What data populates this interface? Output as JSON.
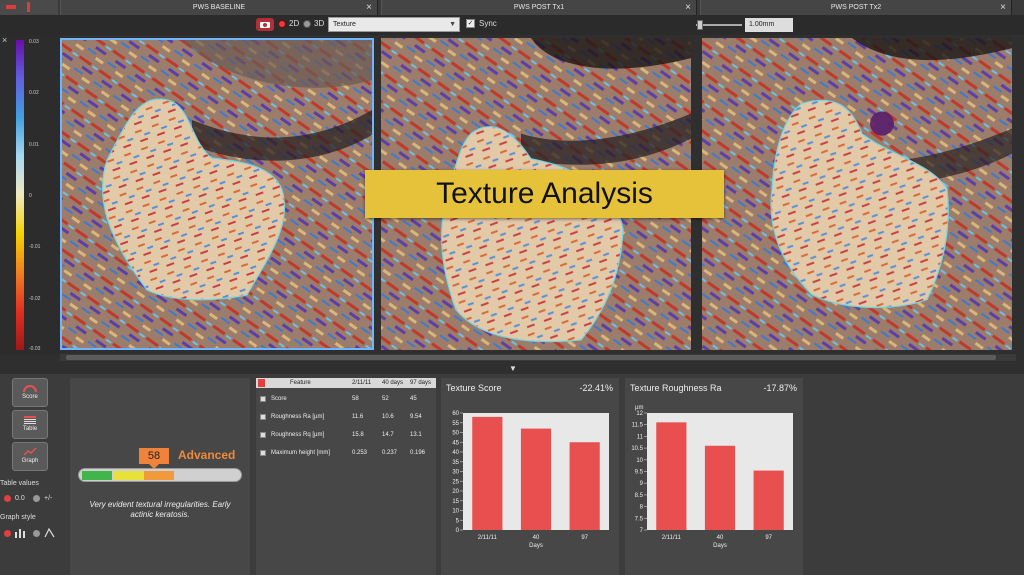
{
  "tabs": [
    {
      "label": "PWS BASELINE"
    },
    {
      "label": "PWS  POST Tx1"
    },
    {
      "label": "PWS POST Tx2"
    }
  ],
  "toolbar": {
    "mode_2d": "2D",
    "mode_3d": "3D",
    "view_select": "Texture",
    "sync_label": "Sync",
    "resolution": "1.00mm"
  },
  "colorbar": {
    "ticks": [
      "0.03",
      "0.02",
      "0.01",
      "0",
      "-0.01",
      "-0.02",
      "-0.03"
    ]
  },
  "banner": {
    "text": "Texture Analysis"
  },
  "view_buttons": [
    {
      "label": "Score",
      "icon": "gauge-icon"
    },
    {
      "label": "Table",
      "icon": "table-icon"
    },
    {
      "label": "Graph",
      "icon": "line-graph-icon"
    }
  ],
  "table_values": {
    "label": "Table values",
    "option_1": "0.0",
    "option_2": "+/-"
  },
  "graph_style": {
    "label": "Graph style"
  },
  "score": {
    "value": "58",
    "level": "Advanced",
    "level_color": "#f08a3a",
    "description": "Very evident textural irregularities. Early actinic keratosis.",
    "gauge_fraction": 0.58
  },
  "table": {
    "headers": [
      "Feature",
      "2/11/11",
      "40 days",
      "97 days"
    ],
    "rows": [
      [
        "Score",
        "58",
        "52",
        "45"
      ],
      [
        "Roughness Ra [µm]",
        "11.6",
        "10.6",
        "9.54"
      ],
      [
        "Roughness Rq [µm]",
        "15.8",
        "14.7",
        "13.1"
      ],
      [
        "Maximum height [mm]",
        "0.253",
        "0.237",
        "0.196"
      ]
    ]
  },
  "chart_data": [
    {
      "type": "bar",
      "title": "Texture Score",
      "change": "-22.41%",
      "categories": [
        "2/11/11",
        "40",
        "97"
      ],
      "values": [
        58,
        52,
        45
      ],
      "xlabel": "Days",
      "ylabel": "",
      "ylim": [
        0,
        60
      ],
      "yticks": [
        0,
        5,
        10,
        15,
        20,
        25,
        30,
        35,
        40,
        45,
        50,
        55,
        60
      ],
      "bar_color": "#e85050"
    },
    {
      "type": "bar",
      "title": "Texture Roughness Ra",
      "change": "-17.87%",
      "categories": [
        "2/11/11",
        "40",
        "97"
      ],
      "values": [
        11.6,
        10.6,
        9.54
      ],
      "xlabel": "Days",
      "ylabel": "µm",
      "ylim": [
        7,
        12
      ],
      "yticks": [
        7,
        7.5,
        8,
        8.5,
        9,
        9.5,
        10,
        10.5,
        11,
        11.5,
        12
      ],
      "bar_color": "#e85050"
    }
  ]
}
